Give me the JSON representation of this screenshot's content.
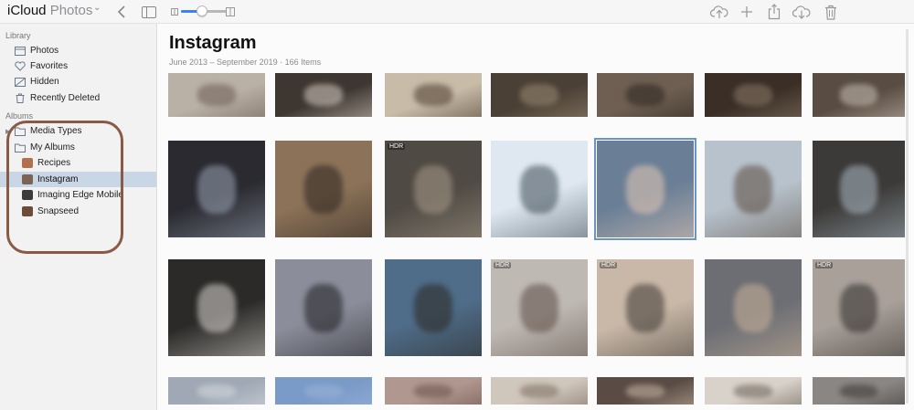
{
  "app": {
    "brand_main": "iCloud",
    "brand_sub": "Photos",
    "brand_caret": "⌄"
  },
  "toolbar": {
    "icons": [
      "back-chevron-icon",
      "sidebar-toggle-icon",
      "zoom-small-icon",
      "zoom-large-icon",
      "upload-icon",
      "add-icon",
      "share-icon",
      "download-icon",
      "trash-icon"
    ],
    "zoom_level": 0.45,
    "accent": "#3a82f7"
  },
  "sidebar": {
    "library_label": "Library",
    "library_items": [
      {
        "label": "Photos",
        "icon": "photos-icon"
      },
      {
        "label": "Favorites",
        "icon": "heart-icon"
      },
      {
        "label": "Hidden",
        "icon": "hidden-icon"
      },
      {
        "label": "Recently Deleted",
        "icon": "trash-icon"
      }
    ],
    "albums_label": "Albums",
    "album_groups": [
      {
        "label": "Media Types",
        "icon": "folder-icon"
      },
      {
        "label": "My Albums",
        "icon": "folder-icon"
      }
    ],
    "albums": [
      {
        "label": "Recipes",
        "icon": "album-thumb-icon",
        "color": "#b2714e"
      },
      {
        "label": "Instagram",
        "icon": "album-thumb-icon",
        "color": "#7b6455",
        "active": true
      },
      {
        "label": "Imaging Edge Mobile",
        "icon": "album-thumb-icon",
        "color": "#3a3a3a"
      },
      {
        "label": "Snapseed",
        "icon": "album-thumb-icon",
        "color": "#6e4a38"
      }
    ],
    "highlight_ring_color": "#8b5a47"
  },
  "main": {
    "title": "Instagram",
    "subtitle": "June 2013 – September 2019  ·  166 Items",
    "hdr_badge": "HDR",
    "rows": [
      [
        {
          "bg": "#b9b0a6",
          "accent": "#6b5c52"
        },
        {
          "bg": "#3e3630",
          "accent": "#d8d0c6"
        },
        {
          "bg": "#c8bba8",
          "accent": "#4a3a2c"
        },
        {
          "bg": "#4b4036",
          "accent": "#9a8a72"
        },
        {
          "bg": "#6e5f52",
          "accent": "#2c241e"
        },
        {
          "bg": "#3a2e26",
          "accent": "#8a7a68"
        },
        {
          "bg": "#594c42",
          "accent": "#c9c0b4"
        }
      ],
      [
        {
          "bg": "#2a2a30",
          "accent": "#9aa3b5"
        },
        {
          "bg": "#8c7258",
          "accent": "#2a2420"
        },
        {
          "bg": "#4f4a44",
          "accent": "#a89a88",
          "hdr": true
        },
        {
          "bg": "#dfe8f0",
          "accent": "#3c4a55"
        },
        {
          "bg": "#6a7f96",
          "accent": "#e6c9b6",
          "selected": true
        },
        {
          "bg": "#b7c2cc",
          "accent": "#5a4a3e"
        },
        {
          "bg": "#3c3a38",
          "accent": "#a9b8c4"
        }
      ],
      [
        {
          "bg": "#2c2a28",
          "accent": "#d9d6d2"
        },
        {
          "bg": "#8b8e9a",
          "accent": "#1e1c22"
        },
        {
          "bg": "#4f6c88",
          "accent": "#2a2620"
        },
        {
          "bg": "#bfb9b4",
          "accent": "#5c4c44",
          "hdr": true
        },
        {
          "bg": "#c9b8a7",
          "accent": "#3b3632",
          "hdr": true
        },
        {
          "bg": "#6c6e74",
          "accent": "#ccb39a"
        },
        {
          "bg": "#a9a09a",
          "accent": "#2e2b28",
          "hdr": true
        }
      ],
      [
        {
          "bg": "#9fa8b4",
          "accent": "#d6dbe2"
        },
        {
          "bg": "#7a9ac8",
          "accent": "#9ab4d8"
        },
        {
          "bg": "#b09890",
          "accent": "#6a5048"
        },
        {
          "bg": "#cfc6bc",
          "accent": "#7a6a5e"
        },
        {
          "bg": "#5a4c44",
          "accent": "#c8b6a8"
        },
        {
          "bg": "#d8d2ca",
          "accent": "#6a5e54"
        },
        {
          "bg": "#8a8684",
          "accent": "#3a3634"
        }
      ]
    ]
  }
}
